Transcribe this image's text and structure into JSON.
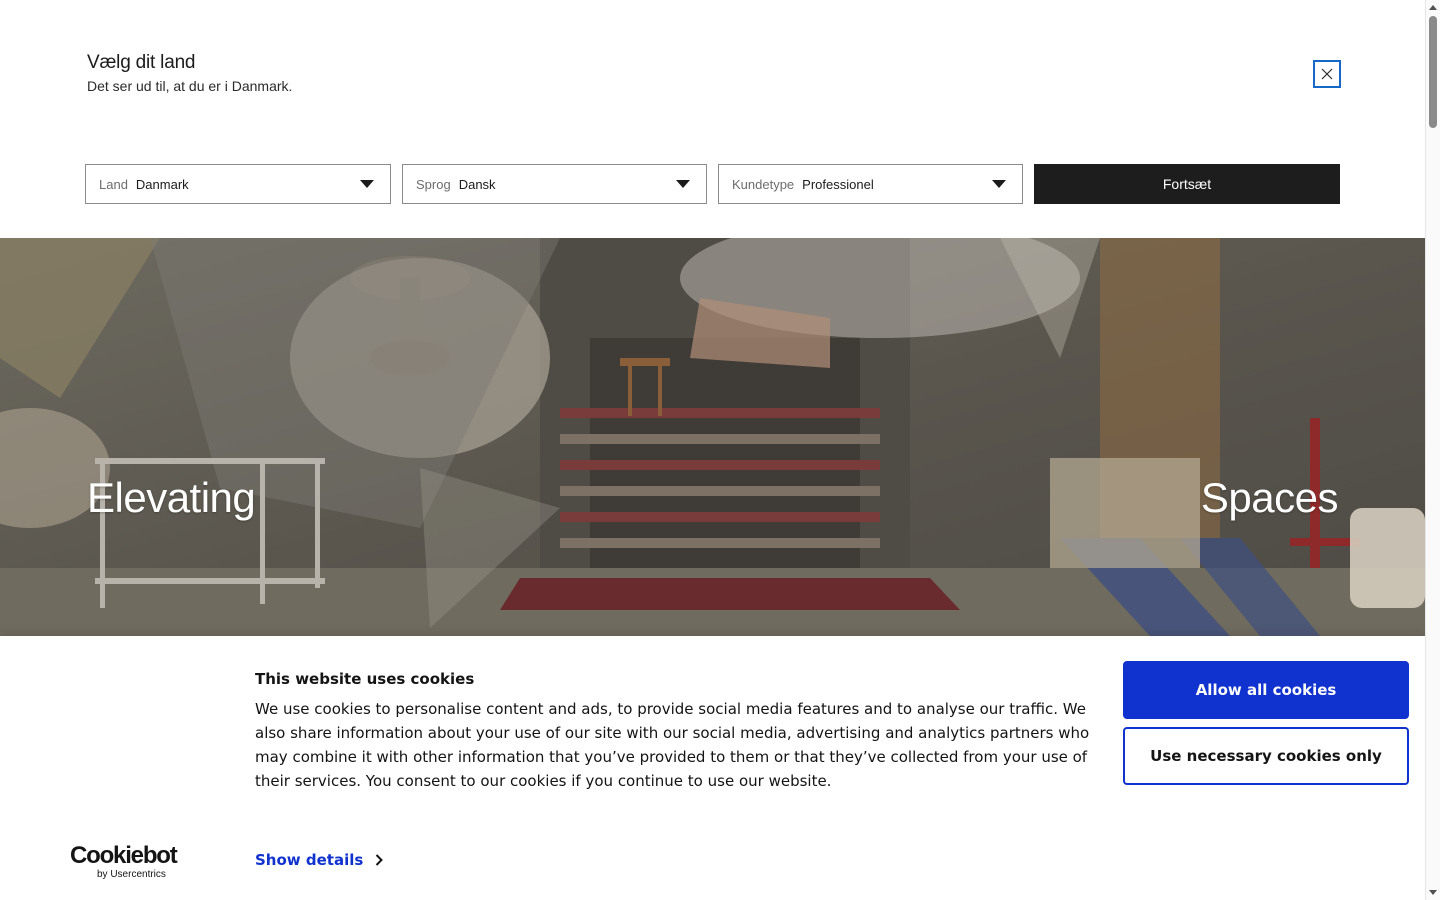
{
  "country_selector": {
    "title": "Vælg dit land",
    "subtitle": "Det ser ud til, at du er i Danmark.",
    "close_icon": "close-icon",
    "country": {
      "label": "Land",
      "value": "Danmark"
    },
    "language": {
      "label": "Sprog",
      "value": "Dansk"
    },
    "customer_type": {
      "label": "Kundetype",
      "value": "Professionel"
    },
    "continue_label": "Fortsæt"
  },
  "hero": {
    "word_left": "Elevating",
    "word_right": "Spaces"
  },
  "cookie_banner": {
    "title": "This website uses cookies",
    "body": "We use cookies to personalise content and ads, to provide social media features and to analyse our traffic. We also share information about your use of our site with our social media, advertising and analytics partners who may combine it with other information that you’ve provided to them or that they’ve collected from your use of their services. You consent to our cookies if you continue to use our website.",
    "show_details": "Show details",
    "allow_all": "Allow all cookies",
    "necessary_only": "Use necessary cookies only",
    "logo_main": "Cookiebot",
    "logo_sub": "by Usercentrics"
  },
  "colors": {
    "accent_blue": "#1032cf",
    "dark_button": "#1d1d1d",
    "focus_outline": "#1568c5"
  }
}
